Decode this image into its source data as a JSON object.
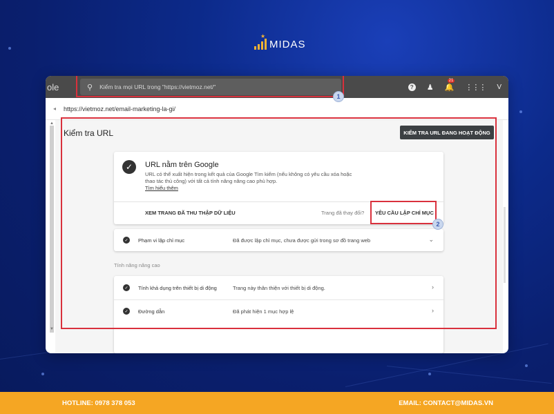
{
  "logo": {
    "text": "MIDAS"
  },
  "topbar": {
    "brand_fragment": "ole",
    "search_placeholder": "Kiểm tra mọi URL trong \"https://vietmoz.net/\"",
    "notification_count": "21",
    "account_initial": "V"
  },
  "url_bar": {
    "current_url": "https://vietmoz.net/email-marketing-la-gi/"
  },
  "panel": {
    "title": "Kiểm tra URL",
    "live_test_button": "KIỂM TRA URL ĐANG HOẠT ĐỘNG"
  },
  "status_card": {
    "title": "URL nằm trên Google",
    "description": "URL có thể xuất hiện trong kết quả của Google Tìm kiếm (nếu không có yêu cầu xóa hoặc thao tác thủ công) với tất cả tính năng nâng cao phù hợp.",
    "learn_more": "Tìm hiểu thêm",
    "view_crawled": "XEM TRANG ĐÃ THU THẬP DỮ LIỆU",
    "changed_question": "Trang đã thay đổi?",
    "request_indexing": "YÊU CẦU LẬP CHỈ MỤC"
  },
  "coverage": {
    "label": "Phạm vi lập chỉ mục",
    "value": "Đã được lập chỉ mục, chưa được gửi trong sơ đồ trang web"
  },
  "enhancements": {
    "section_label": "Tính năng nâng cao",
    "rows": [
      {
        "label": "Tính khả dụng trên thiết bị di động",
        "value": "Trang này thân thiện với thiết bị di động."
      },
      {
        "label": "Đường dẫn",
        "value": "Đã phát hiện 1 mục hợp lệ"
      }
    ]
  },
  "annotations": {
    "badge_1": "1",
    "badge_2": "2"
  },
  "footer": {
    "hotline": "HOTLINE: 0978 378 053",
    "email": "EMAIL: CONTACT@MIDAS.VN"
  },
  "colors": {
    "background": "#0c2a8a",
    "accent": "#f5a623",
    "highlight_frame": "#d9303c"
  }
}
